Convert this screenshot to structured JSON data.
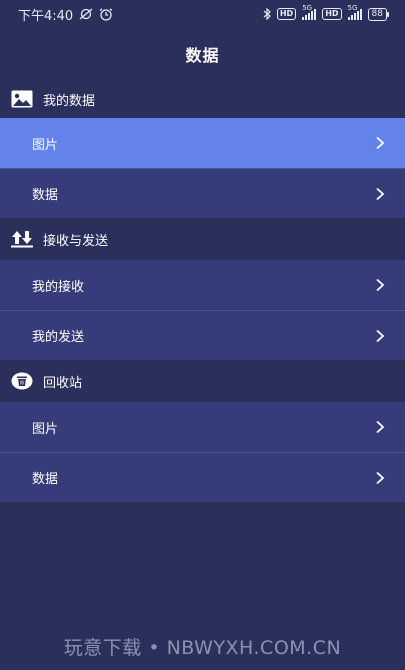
{
  "status_bar": {
    "time": "下午4:40",
    "hd1": "HD",
    "hd2": "HD",
    "net1": "5G",
    "net2": "5G",
    "battery": "88"
  },
  "header": {
    "title": "数据"
  },
  "sections": [
    {
      "title": "我的数据",
      "icon": "image-icon",
      "items": [
        {
          "label": "图片",
          "active": true
        },
        {
          "label": "数据",
          "active": false
        }
      ]
    },
    {
      "title": "接收与发送",
      "icon": "transfer-arrows-icon",
      "items": [
        {
          "label": "我的接收",
          "active": false
        },
        {
          "label": "我的发送",
          "active": false
        }
      ]
    },
    {
      "title": "回收站",
      "icon": "trash-icon",
      "items": [
        {
          "label": "图片",
          "active": false
        },
        {
          "label": "数据",
          "active": false
        }
      ]
    }
  ],
  "watermark": "玩意下载 • NBWYXH.COM.CN",
  "colors": {
    "background": "#2a2f5c",
    "row": "#363c7a",
    "active_row": "#6483ea"
  }
}
